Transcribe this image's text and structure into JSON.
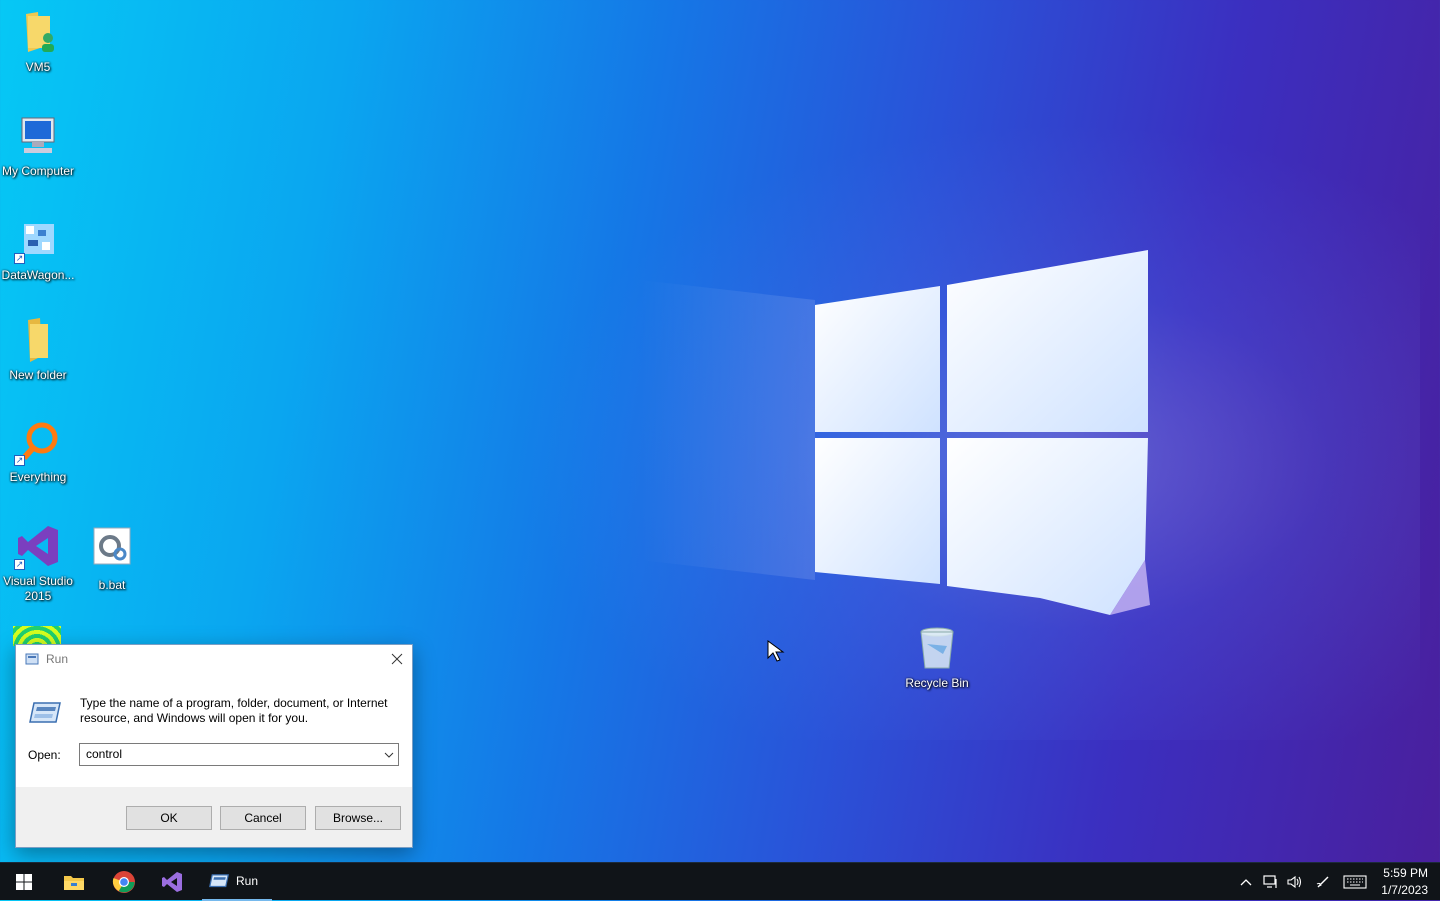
{
  "desktop": {
    "icons": [
      {
        "label": "VM5",
        "icon": "user-folder-icon"
      },
      {
        "label": "My Computer",
        "icon": "computer-icon"
      },
      {
        "label": "DataWagon...",
        "icon": "app-shortcut-icon"
      },
      {
        "label": "New folder",
        "icon": "folder-icon"
      },
      {
        "label": "Everything",
        "icon": "search-shortcut-icon"
      },
      {
        "label": "Visual Studio 2015",
        "icon": "visual-studio-icon"
      },
      {
        "label": "b.bat",
        "icon": "batch-file-icon"
      },
      {
        "label": "Recycle Bin",
        "icon": "recycle-bin-icon"
      }
    ]
  },
  "run_dialog": {
    "title": "Run",
    "description": "Type the name of a program, folder, document, or Internet resource, and Windows will open it for you.",
    "open_label": "Open:",
    "open_value": "control",
    "buttons": {
      "ok": "OK",
      "cancel": "Cancel",
      "browse": "Browse..."
    }
  },
  "taskbar": {
    "apps": [
      "start",
      "file-explorer",
      "chrome",
      "visual-studio"
    ],
    "running_app_label": "Run",
    "clock": {
      "time": "5:59 PM",
      "date": "1/7/2023"
    }
  },
  "colors": {
    "taskbar": "#101418",
    "wallpaper_left": "#06c8f5",
    "wallpaper_right": "#4a1f9c"
  }
}
